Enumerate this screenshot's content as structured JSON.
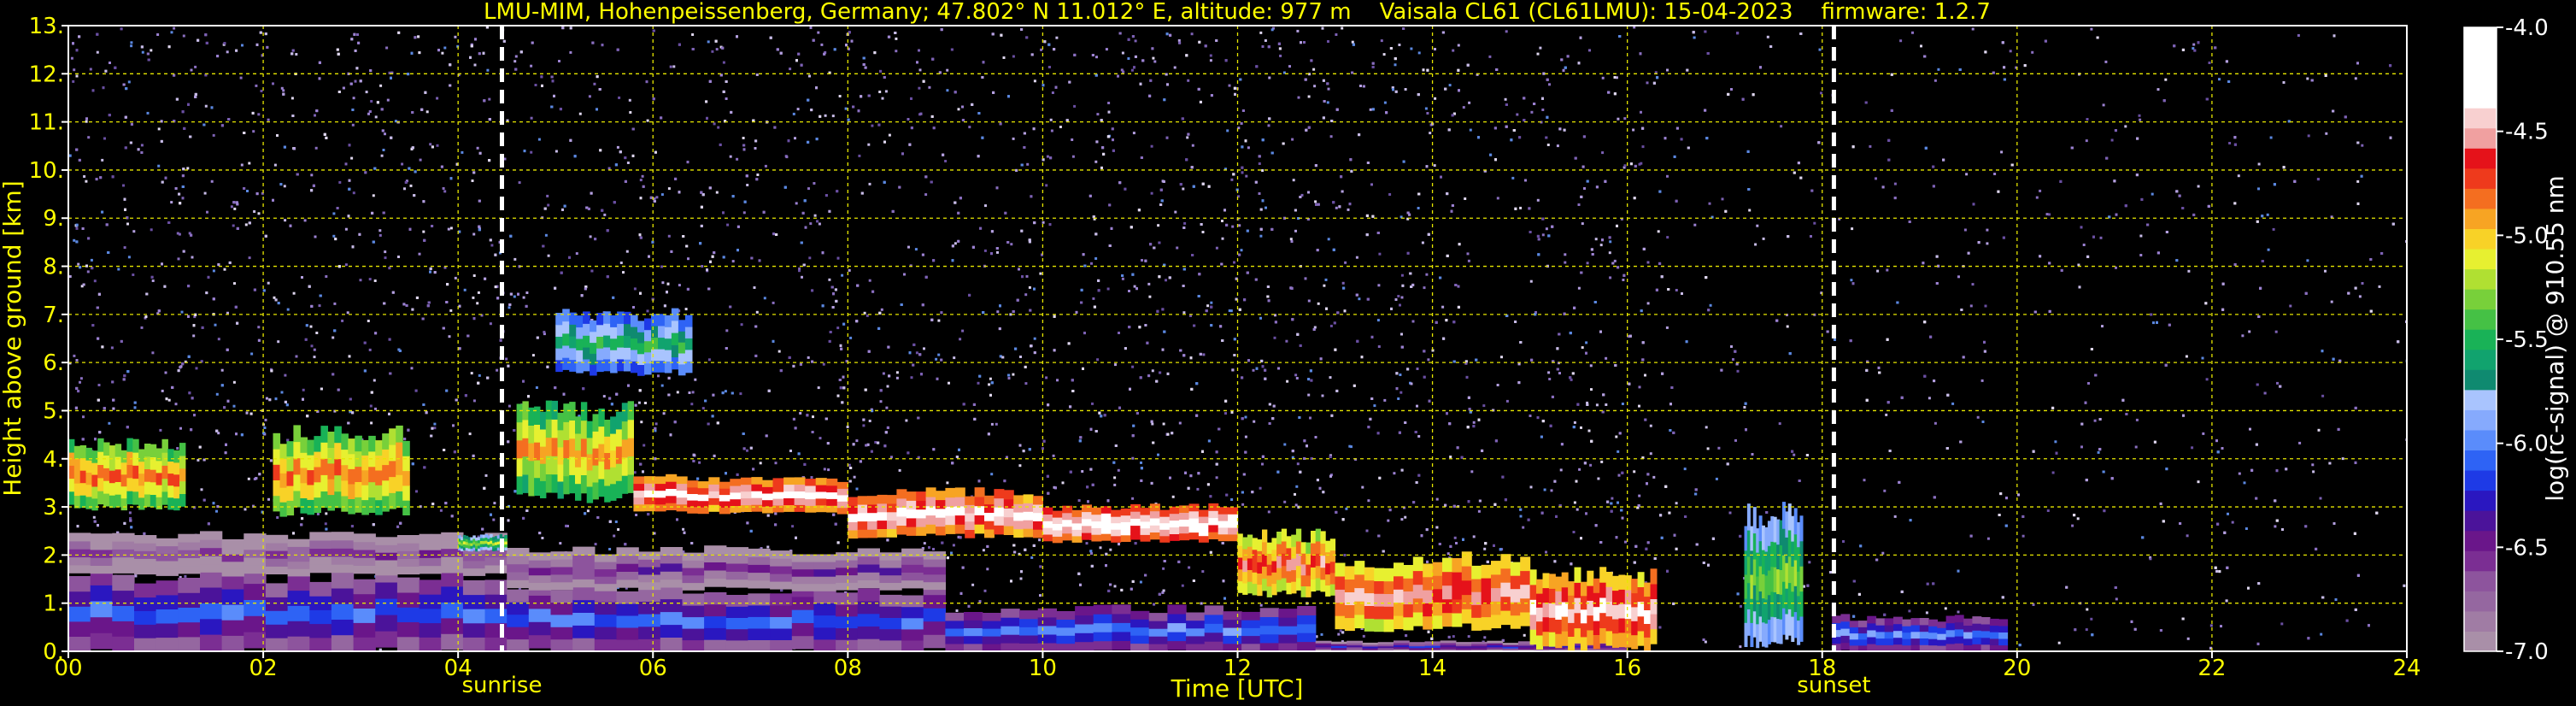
{
  "chart_data": {
    "type": "heatmap",
    "title": "LMU-MIM, Hohenpeissenberg, Germany; 47.802° N 11.012° E, altitude: 977 m    Vaisala CL61 (CL61LMU): 15-04-2023    firmware: 1.2.7",
    "xlabel": "Time [UTC]",
    "ylabel": "Height above ground [km]",
    "xlim": [
      0,
      24
    ],
    "ylim": [
      0,
      13
    ],
    "x_ticks": [
      "00",
      "02",
      "04",
      "06",
      "08",
      "10",
      "12",
      "14",
      "16",
      "18",
      "20",
      "22",
      "24"
    ],
    "y_ticks": [
      "0.",
      "1.",
      "2.",
      "3.",
      "4.",
      "5.",
      "6.",
      "7.",
      "8.",
      "9.",
      "10.",
      "11.",
      "12.",
      "13."
    ],
    "grid": true,
    "annotations": [
      {
        "label": "sunrise",
        "x": 4.45
      },
      {
        "label": "sunset",
        "x": 18.12
      }
    ],
    "colorbar": {
      "label": "log(rc-signal) @ 910.55 nm",
      "ticks": [
        "-4.0",
        "-4.5",
        "-5.0",
        "-5.5",
        "-6.0",
        "-6.5",
        "-7.0"
      ],
      "range": [
        -7.0,
        -4.0
      ],
      "colors": [
        "#a98fa8",
        "#a07ca4",
        "#9567a0",
        "#8d549d",
        "#7b2e93",
        "#6a168a",
        "#4b139a",
        "#2a17c0",
        "#1e3ae6",
        "#2e63f5",
        "#5a8cfb",
        "#86aafd",
        "#a9c4fe",
        "#0f8a70",
        "#11a36e",
        "#19b257",
        "#45c145",
        "#78d03a",
        "#b0e032",
        "#e7f030",
        "#f8d227",
        "#f7a423",
        "#f46e20",
        "#ee3a1c",
        "#e5121a",
        "#f0a0a0",
        "#f8d0d0",
        "#ffffff",
        "#ffffff",
        "#ffffff",
        "#ffffff"
      ]
    },
    "layers": [
      {
        "t0": 0.0,
        "t1": 1.2,
        "z0": 3.0,
        "z1": 4.3,
        "intensity": -4.8
      },
      {
        "t0": 2.1,
        "t1": 3.5,
        "z0": 2.9,
        "z1": 4.5,
        "intensity": -4.8
      },
      {
        "t0": 4.0,
        "t1": 4.5,
        "z0": 2.1,
        "z1": 2.4,
        "intensity": -5.2
      },
      {
        "t0": 4.6,
        "t1": 5.8,
        "z0": 3.2,
        "z1": 5.0,
        "intensity": -4.9
      },
      {
        "t0": 5.0,
        "t1": 6.4,
        "z0": 5.8,
        "z1": 7.0,
        "intensity": -5.5
      },
      {
        "t0": 5.8,
        "t1": 8.0,
        "z0": 2.9,
        "z1": 3.6,
        "intensity": -4.3
      },
      {
        "t0": 8.0,
        "t1": 10.0,
        "z0": 2.4,
        "z1": 3.3,
        "intensity": -4.3
      },
      {
        "t0": 10.0,
        "t1": 12.0,
        "z0": 2.3,
        "z1": 3.0,
        "intensity": -4.2
      },
      {
        "t0": 12.0,
        "t1": 13.0,
        "z0": 1.2,
        "z1": 2.4,
        "intensity": -4.6
      },
      {
        "t0": 13.0,
        "t1": 15.0,
        "z0": 0.5,
        "z1": 1.9,
        "intensity": -4.5
      },
      {
        "t0": 15.0,
        "t1": 16.3,
        "z0": 0.1,
        "z1": 1.6,
        "intensity": -4.4
      },
      {
        "t0": 17.2,
        "t1": 17.8,
        "z0": 0.2,
        "z1": 2.8,
        "intensity": -5.3
      },
      {
        "t0": 18.1,
        "t1": 19.9,
        "z0": 0.0,
        "z1": 0.7,
        "intensity": -6.0
      }
    ],
    "boundary_layer": [
      {
        "t0": 0.0,
        "t1": 4.5,
        "z0": 0.0,
        "z1": 1.6,
        "intensity": -6.1
      },
      {
        "t0": 0.0,
        "t1": 4.5,
        "z0": 1.6,
        "z1": 2.4,
        "intensity": -6.6
      },
      {
        "t0": 4.5,
        "t1": 9.0,
        "z0": 0.0,
        "z1": 1.3,
        "intensity": -6.1
      },
      {
        "t0": 4.5,
        "t1": 9.0,
        "z0": 1.3,
        "z1": 2.1,
        "intensity": -6.5
      },
      {
        "t0": 9.0,
        "t1": 12.8,
        "z0": 0.0,
        "z1": 0.9,
        "intensity": -6.0
      },
      {
        "t0": 12.8,
        "t1": 16.0,
        "z0": 0.0,
        "z1": 0.2,
        "intensity": -6.3
      }
    ]
  }
}
